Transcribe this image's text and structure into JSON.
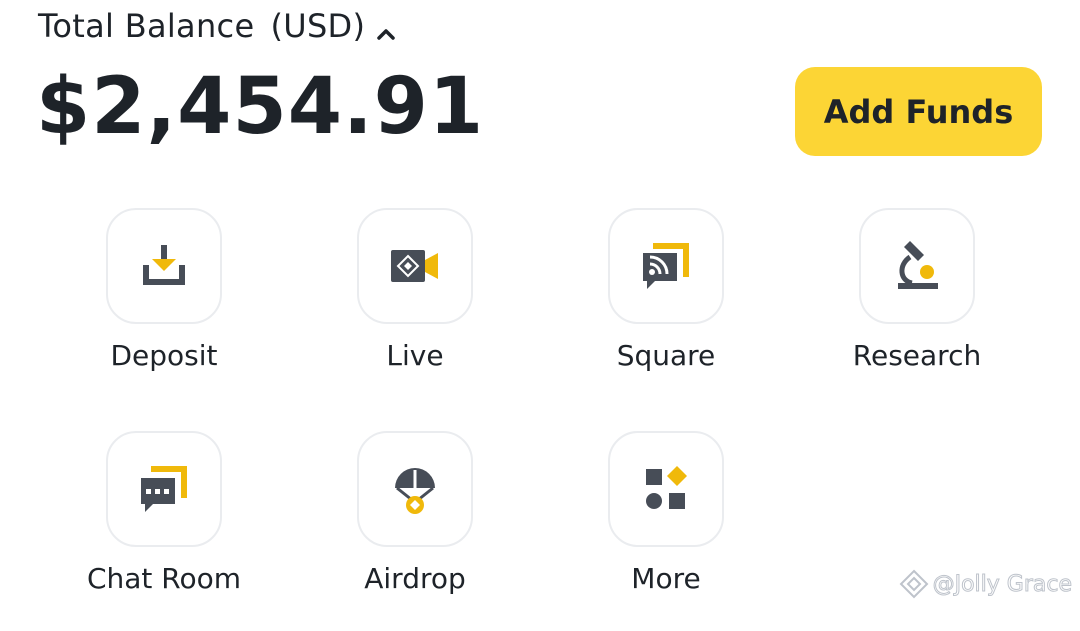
{
  "balance": {
    "label": "Total Balance",
    "currency": "(USD)",
    "amount": "$2,454.91",
    "expand_icon": "chevron-up-icon"
  },
  "actions": {
    "add_funds_label": "Add Funds"
  },
  "shortcuts": [
    {
      "label": "Deposit",
      "icon": "deposit-icon"
    },
    {
      "label": "Live",
      "icon": "live-icon"
    },
    {
      "label": "Square",
      "icon": "square-icon"
    },
    {
      "label": "Research",
      "icon": "research-icon"
    },
    {
      "label": "Chat Room",
      "icon": "chat-room-icon"
    },
    {
      "label": "Airdrop",
      "icon": "airdrop-icon"
    },
    {
      "label": "More",
      "icon": "more-icon"
    }
  ],
  "watermark": {
    "text": "@Jolly Grace",
    "icon": "binance-logo-icon"
  },
  "colors": {
    "accent": "#FCD535",
    "icon_dark": "#474D57",
    "icon_yellow": "#F0B90B",
    "text": "#1E2329",
    "tile_border": "#EAECEF"
  }
}
